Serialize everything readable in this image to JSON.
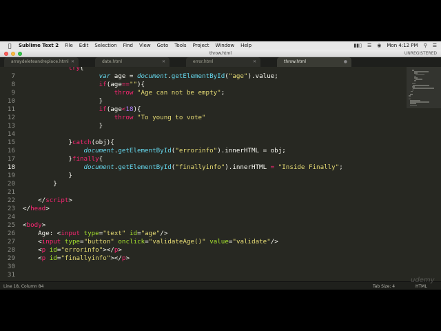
{
  "menubar": {
    "app_name": "Sublime Text 2",
    "items": [
      "File",
      "Edit",
      "Selection",
      "Find",
      "View",
      "Goto",
      "Tools",
      "Project",
      "Window",
      "Help"
    ],
    "clock": "Mon 4:12 PM"
  },
  "window": {
    "title": "throw.html",
    "registration": "UNREGISTERED"
  },
  "tabs": [
    {
      "label": "arraydeleteandreplace.html",
      "active": false
    },
    {
      "label": "date.html",
      "active": false
    },
    {
      "label": "error.html",
      "active": false
    },
    {
      "label": "throw.html",
      "active": true
    }
  ],
  "editor": {
    "current_line": 18,
    "lines": [
      {
        "n": "",
        "code": [
          {
            "c": "p",
            "t": "            "
          },
          {
            "c": "k",
            "t": "try"
          },
          {
            "c": "p",
            "t": "{"
          }
        ]
      },
      {
        "n": "7",
        "code": [
          {
            "c": "p",
            "t": "                    "
          },
          {
            "c": "i",
            "t": "var"
          },
          {
            "c": "p",
            "t": " age = "
          },
          {
            "c": "i",
            "t": "document"
          },
          {
            "c": "p",
            "t": "."
          },
          {
            "c": "f",
            "t": "getElementById"
          },
          {
            "c": "p",
            "t": "("
          },
          {
            "c": "s",
            "t": "\"age\""
          },
          {
            "c": "p",
            "t": ").value;"
          }
        ]
      },
      {
        "n": "8",
        "code": [
          {
            "c": "p",
            "t": "                    "
          },
          {
            "c": "k",
            "t": "if"
          },
          {
            "c": "p",
            "t": "(age"
          },
          {
            "c": "k",
            "t": "=="
          },
          {
            "c": "s",
            "t": "\"\""
          },
          {
            "c": "p",
            "t": "){"
          }
        ]
      },
      {
        "n": "9",
        "code": [
          {
            "c": "p",
            "t": "                        "
          },
          {
            "c": "k",
            "t": "throw"
          },
          {
            "c": "p",
            "t": " "
          },
          {
            "c": "s",
            "t": "\"Age can not be empty\""
          },
          {
            "c": "p",
            "t": ";"
          }
        ]
      },
      {
        "n": "10",
        "code": [
          {
            "c": "p",
            "t": "                    }"
          }
        ]
      },
      {
        "n": "11",
        "code": [
          {
            "c": "p",
            "t": "                    "
          },
          {
            "c": "k",
            "t": "if"
          },
          {
            "c": "p",
            "t": "(age"
          },
          {
            "c": "k",
            "t": "<"
          },
          {
            "c": "n",
            "t": "18"
          },
          {
            "c": "p",
            "t": "){"
          }
        ]
      },
      {
        "n": "12",
        "code": [
          {
            "c": "p",
            "t": "                        "
          },
          {
            "c": "k",
            "t": "throw"
          },
          {
            "c": "p",
            "t": " "
          },
          {
            "c": "s",
            "t": "\"To young to vote\""
          }
        ]
      },
      {
        "n": "13",
        "code": [
          {
            "c": "p",
            "t": "                    }"
          }
        ]
      },
      {
        "n": "14",
        "code": []
      },
      {
        "n": "15",
        "code": [
          {
            "c": "p",
            "t": "            }"
          },
          {
            "c": "k",
            "t": "catch"
          },
          {
            "c": "p",
            "t": "(obj){"
          }
        ]
      },
      {
        "n": "16",
        "code": [
          {
            "c": "p",
            "t": "                "
          },
          {
            "c": "i",
            "t": "document"
          },
          {
            "c": "p",
            "t": "."
          },
          {
            "c": "f",
            "t": "getElementById"
          },
          {
            "c": "p",
            "t": "("
          },
          {
            "c": "s",
            "t": "\"errorinfo\""
          },
          {
            "c": "p",
            "t": ").innerHTML = obj;"
          }
        ]
      },
      {
        "n": "17",
        "code": [
          {
            "c": "p",
            "t": "            }"
          },
          {
            "c": "k",
            "t": "finally"
          },
          {
            "c": "p",
            "t": "{"
          }
        ]
      },
      {
        "n": "18",
        "code": [
          {
            "c": "p",
            "t": "                "
          },
          {
            "c": "i",
            "t": "document"
          },
          {
            "c": "p",
            "t": "."
          },
          {
            "c": "f",
            "t": "getElementById"
          },
          {
            "c": "p",
            "t": "("
          },
          {
            "c": "s",
            "t": "\"finallyinfo\""
          },
          {
            "c": "p",
            "t": ").innerHTML "
          },
          {
            "c": "k",
            "t": "="
          },
          {
            "c": "p",
            "t": " "
          },
          {
            "c": "s",
            "t": "\"Inside Finally\""
          },
          {
            "c": "p",
            "t": ";"
          }
        ]
      },
      {
        "n": "19",
        "code": [
          {
            "c": "p",
            "t": "            }"
          }
        ]
      },
      {
        "n": "20",
        "code": [
          {
            "c": "p",
            "t": "        }"
          }
        ]
      },
      {
        "n": "21",
        "code": []
      },
      {
        "n": "22",
        "code": [
          {
            "c": "p",
            "t": "    </"
          },
          {
            "c": "t",
            "t": "script"
          },
          {
            "c": "p",
            "t": ">"
          }
        ]
      },
      {
        "n": "23",
        "code": [
          {
            "c": "p",
            "t": "</"
          },
          {
            "c": "t",
            "t": "head"
          },
          {
            "c": "p",
            "t": ">"
          }
        ]
      },
      {
        "n": "24",
        "code": []
      },
      {
        "n": "25",
        "code": [
          {
            "c": "p",
            "t": "<"
          },
          {
            "c": "t",
            "t": "body"
          },
          {
            "c": "p",
            "t": ">"
          }
        ]
      },
      {
        "n": "26",
        "code": [
          {
            "c": "p",
            "t": "    Age: <"
          },
          {
            "c": "t",
            "t": "input"
          },
          {
            "c": "p",
            "t": " "
          },
          {
            "c": "g",
            "t": "type"
          },
          {
            "c": "p",
            "t": "="
          },
          {
            "c": "s",
            "t": "\"text\""
          },
          {
            "c": "p",
            "t": " "
          },
          {
            "c": "g",
            "t": "id"
          },
          {
            "c": "p",
            "t": "="
          },
          {
            "c": "s",
            "t": "\"age\""
          },
          {
            "c": "p",
            "t": "/>"
          }
        ]
      },
      {
        "n": "27",
        "code": [
          {
            "c": "p",
            "t": "    <"
          },
          {
            "c": "t",
            "t": "input"
          },
          {
            "c": "p",
            "t": " "
          },
          {
            "c": "g",
            "t": "type"
          },
          {
            "c": "p",
            "t": "="
          },
          {
            "c": "s",
            "t": "\"button\""
          },
          {
            "c": "p",
            "t": " "
          },
          {
            "c": "g",
            "t": "onclick"
          },
          {
            "c": "p",
            "t": "="
          },
          {
            "c": "s",
            "t": "\"validateAge()\""
          },
          {
            "c": "p",
            "t": " "
          },
          {
            "c": "g",
            "t": "value"
          },
          {
            "c": "p",
            "t": "="
          },
          {
            "c": "s",
            "t": "\"validate\""
          },
          {
            "c": "p",
            "t": "/>"
          }
        ]
      },
      {
        "n": "28",
        "code": [
          {
            "c": "p",
            "t": "    <"
          },
          {
            "c": "t",
            "t": "p"
          },
          {
            "c": "p",
            "t": " "
          },
          {
            "c": "g",
            "t": "id"
          },
          {
            "c": "p",
            "t": "="
          },
          {
            "c": "s",
            "t": "\"errorinfo\""
          },
          {
            "c": "p",
            "t": "></"
          },
          {
            "c": "t",
            "t": "p"
          },
          {
            "c": "p",
            "t": ">"
          }
        ]
      },
      {
        "n": "29",
        "code": [
          {
            "c": "p",
            "t": "    <"
          },
          {
            "c": "t",
            "t": "p"
          },
          {
            "c": "p",
            "t": " "
          },
          {
            "c": "g",
            "t": "id"
          },
          {
            "c": "p",
            "t": "="
          },
          {
            "c": "s",
            "t": "\"finallyinfo\""
          },
          {
            "c": "p",
            "t": "></"
          },
          {
            "c": "t",
            "t": "p"
          },
          {
            "c": "p",
            "t": ">"
          }
        ]
      },
      {
        "n": "30",
        "code": []
      },
      {
        "n": "31",
        "code": []
      }
    ]
  },
  "statusbar": {
    "position": "Line 18, Column 84",
    "tab_size": "Tab Size: 4",
    "syntax": "HTML"
  },
  "watermark": "udemy",
  "colors": {
    "background": "#272822",
    "keyword": "#f92672",
    "string": "#e6db74",
    "function": "#66d9ef",
    "attribute": "#a6e22e",
    "number": "#ae81ff"
  },
  "icons": [
    "apple-icon",
    "battery-icon",
    "wifi-icon",
    "search-icon",
    "notification-icon"
  ]
}
